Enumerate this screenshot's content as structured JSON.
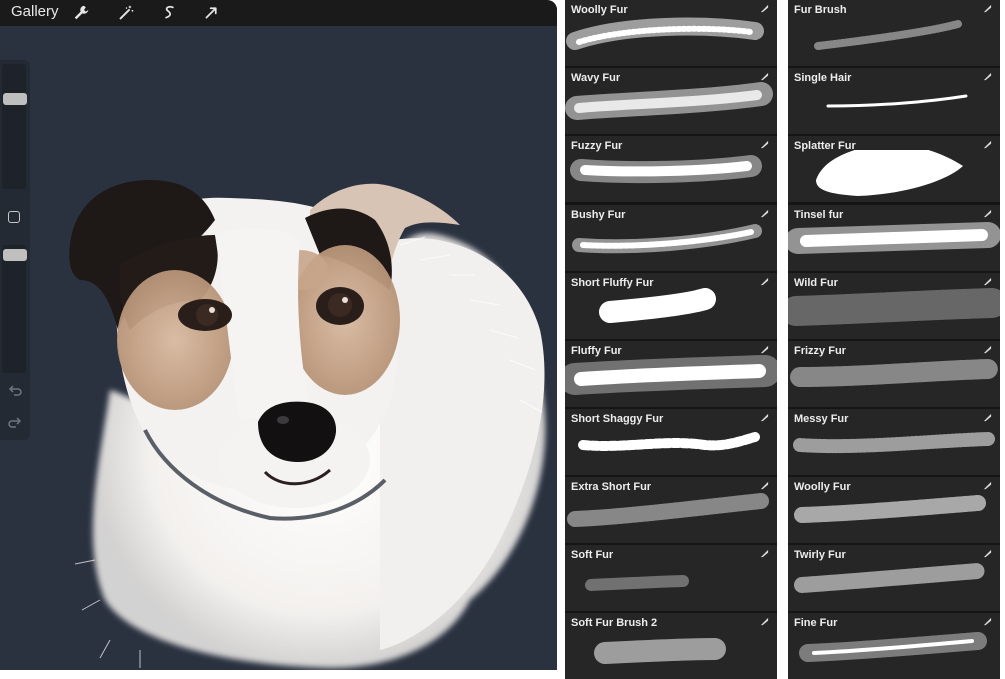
{
  "toolbar": {
    "gallery_label": "Gallery",
    "tools": [
      {
        "icon": "wrench-icon"
      },
      {
        "icon": "magic-wand-icon"
      },
      {
        "icon": "selection-s-icon"
      },
      {
        "icon": "arrow-cursor-icon"
      }
    ]
  },
  "sidebar": {
    "brush_size_level": 0.2,
    "opacity_level": 0.1,
    "undo_icon": "undo-icon",
    "redo_icon": "redo-icon"
  },
  "colors": {
    "canvas_bg": "#2a3240",
    "toolbar_bg": "#1a1a1b",
    "library_bg": "#151515",
    "brush_card_bg": "#262626",
    "text": "#ededed"
  },
  "brush_library": {
    "left_column": [
      {
        "name": "Woolly Fur"
      },
      {
        "name": "Wavy Fur"
      },
      {
        "name": "Fuzzy Fur"
      },
      {
        "name": "Bushy Fur"
      },
      {
        "name": "Short Fluffy Fur"
      },
      {
        "name": "Fluffy Fur"
      },
      {
        "name": "Short Shaggy Fur"
      },
      {
        "name": "Extra Short Fur"
      },
      {
        "name": "Soft Fur"
      },
      {
        "name": "Soft Fur Brush 2"
      }
    ],
    "right_column": [
      {
        "name": "Fur Brush"
      },
      {
        "name": "Single Hair"
      },
      {
        "name": "Splatter Fur"
      },
      {
        "name": "Tinsel fur"
      },
      {
        "name": "Wild Fur"
      },
      {
        "name": "Frizzy Fur"
      },
      {
        "name": "Messy Fur"
      },
      {
        "name": "Woolly Fur"
      },
      {
        "name": "Twirly Fur"
      },
      {
        "name": "Fine Fur"
      }
    ],
    "item_icon": "pen-nib-icon"
  }
}
